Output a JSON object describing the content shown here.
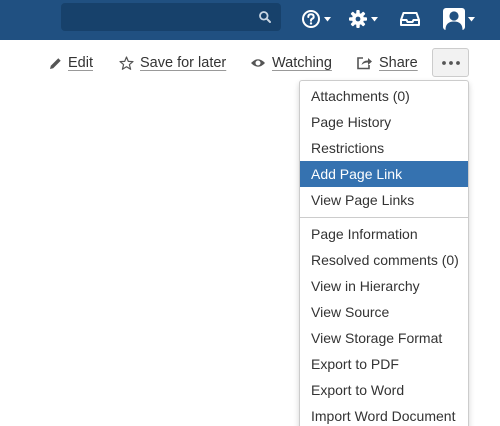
{
  "header": {
    "search_placeholder": "",
    "icons": [
      "search-icon",
      "help-icon",
      "gear-icon",
      "inbox-icon",
      "user-avatar-icon"
    ]
  },
  "toolbar": {
    "edit": "Edit",
    "save_for_later": "Save for later",
    "watching": "Watching",
    "share": "Share",
    "more": "•••"
  },
  "menu": {
    "groups": [
      [
        "Attachments (0)",
        "Page History",
        "Restrictions",
        "Add Page Link",
        "View Page Links"
      ],
      [
        "Page Information",
        "Resolved comments (0)",
        "View in Hierarchy",
        "View Source",
        "View Storage Format",
        "Export to PDF",
        "Export to Word",
        "Import Word Document"
      ]
    ],
    "highlighted": "Add Page Link"
  },
  "colors": {
    "header_bg": "#205081",
    "search_bg": "#17416b",
    "highlight": "#3572b0",
    "text": "#333333"
  }
}
